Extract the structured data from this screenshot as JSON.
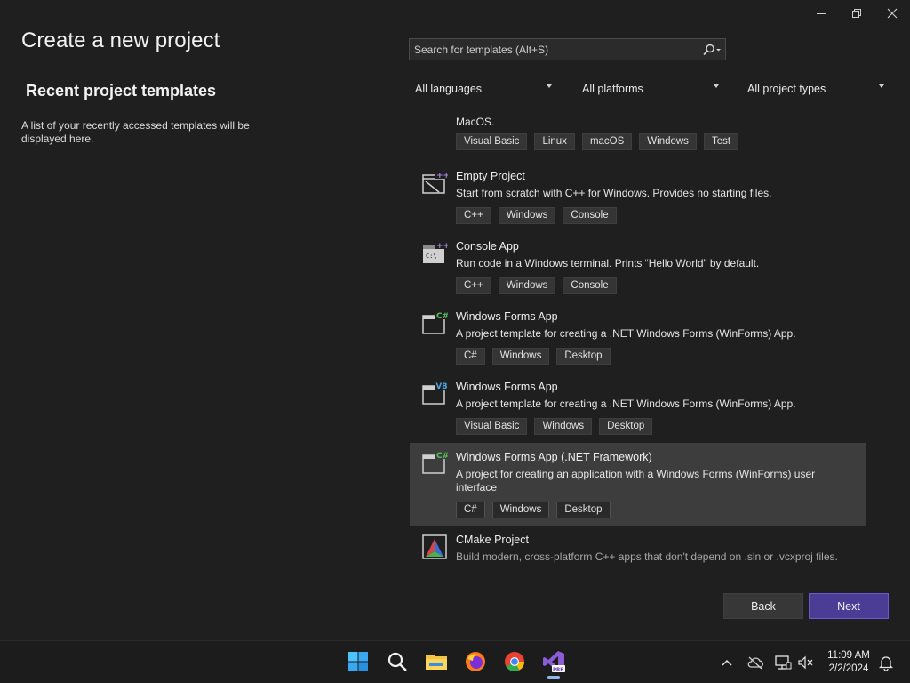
{
  "window": {
    "controls": [
      "minimize",
      "restore",
      "close"
    ]
  },
  "left_panel": {
    "title": "Create a new project",
    "recent_title": "Recent project templates",
    "recent_description": "A list of your recently accessed templates will be displayed here."
  },
  "search": {
    "placeholder": "Search for templates (Alt+S)"
  },
  "filters": {
    "language": "All languages",
    "platform": "All platforms",
    "project_type": "All project types"
  },
  "templates": [
    {
      "name": "",
      "description": "MacOS.",
      "tags": [
        "Visual Basic",
        "Linux",
        "macOS",
        "Windows",
        "Test"
      ],
      "icon": "partial-item"
    },
    {
      "name": "Empty Project",
      "description": "Start from scratch with C++ for Windows. Provides no starting files.",
      "tags": [
        "C++",
        "Windows",
        "Console"
      ],
      "icon": "cpp-empty-project-icon",
      "badge": "++"
    },
    {
      "name": "Console App",
      "description": "Run code in a Windows terminal. Prints “Hello World” by default.",
      "tags": [
        "C++",
        "Windows",
        "Console"
      ],
      "icon": "cpp-console-app-icon",
      "badge": "++",
      "glyph": "C:\\"
    },
    {
      "name": "Windows Forms App",
      "description": "A project template for creating a .NET Windows Forms (WinForms) App.",
      "tags": [
        "C#",
        "Windows",
        "Desktop"
      ],
      "icon": "csharp-winforms-icon",
      "badge": "C#"
    },
    {
      "name": "Windows Forms App",
      "description": "A project template for creating a .NET Windows Forms (WinForms) App.",
      "tags": [
        "Visual Basic",
        "Windows",
        "Desktop"
      ],
      "icon": "vb-winforms-icon",
      "badge": "VB"
    },
    {
      "name": "Windows Forms App (.NET Framework)",
      "description": "A project for creating an application with a Windows Forms (WinForms) user interface",
      "tags": [
        "C#",
        "Windows",
        "Desktop"
      ],
      "icon": "csharp-winforms-framework-icon",
      "badge": "C#",
      "selected": true
    },
    {
      "name": "CMake Project",
      "description": "Build modern, cross-platform C++ apps that don't depend on .sln or .vcxproj files.",
      "tags": [],
      "icon": "cmake-icon"
    }
  ],
  "buttons": {
    "back": "Back",
    "next": "Next"
  },
  "taskbar": {
    "apps": [
      "windows-start-icon",
      "search-icon",
      "file-explorer-icon",
      "firefox-icon",
      "chrome-icon",
      "visual-studio-preview-icon"
    ],
    "vs_badge": "PRE",
    "clock_time": "11:09 AM",
    "clock_date": "2/2/2024"
  },
  "colors": {
    "background": "#1f1f1f",
    "selected_row": "#3d3d3d",
    "accent": "#4b3d96",
    "cpp_badge": "#a486dc",
    "csharp_badge": "#5bbf5b",
    "vb_badge": "#4ea6e8"
  }
}
